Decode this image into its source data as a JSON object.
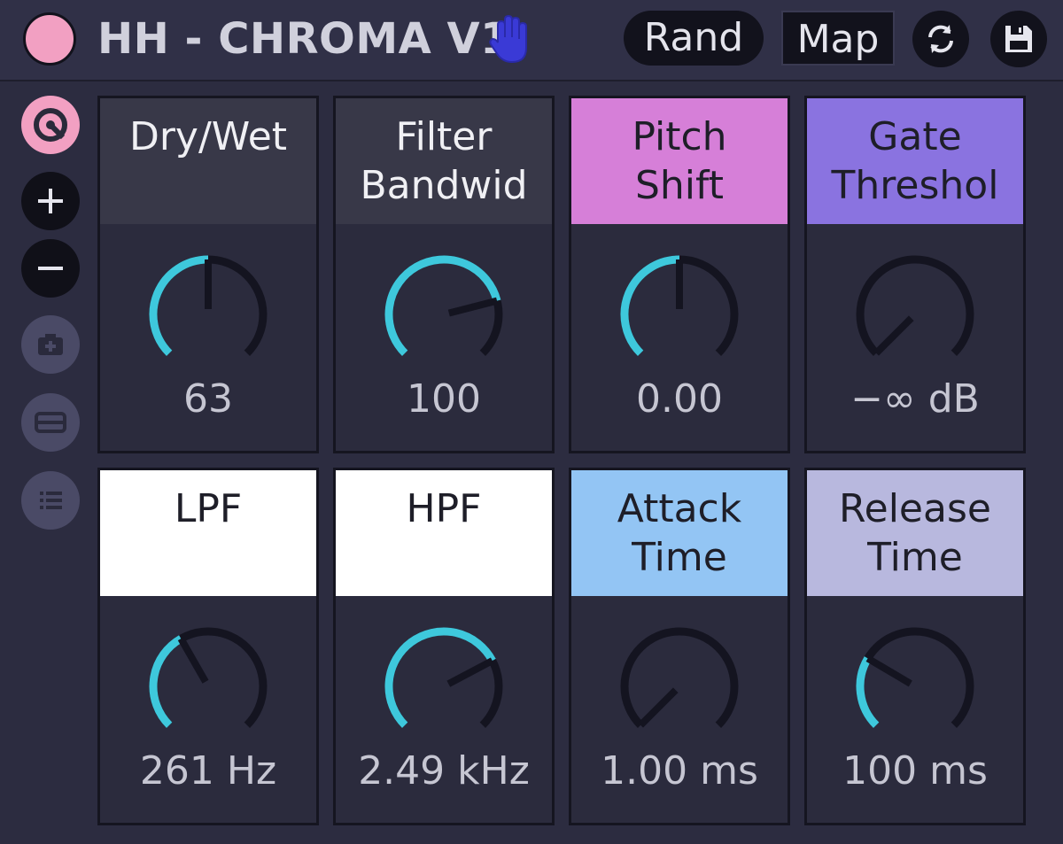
{
  "header": {
    "title": "HH - CHROMA V1",
    "rand_label": "Rand",
    "map_label": "Map",
    "power_color": "#f2a0c2",
    "hand_icon": "hand-icon",
    "sync_icon": "sync-icon",
    "save_icon": "save-icon"
  },
  "sidebar": {
    "items": [
      {
        "name": "chroma-logo-button",
        "icon": "logo-icon"
      },
      {
        "name": "add-button",
        "icon": "plus-icon"
      },
      {
        "name": "remove-button",
        "icon": "minus-icon"
      },
      {
        "name": "snapshot-button",
        "icon": "camera-plus-icon"
      },
      {
        "name": "card-button",
        "icon": "card-icon"
      },
      {
        "name": "list-button",
        "icon": "list-icon"
      }
    ]
  },
  "macros": [
    {
      "label": "Dry/Wet",
      "value": "63",
      "header_color": "#383848",
      "text_color": "#f0f0f4",
      "level": 0.5
    },
    {
      "label": "Filter\nBandwid",
      "value": "100",
      "header_color": "#383848",
      "text_color": "#f0f0f4",
      "level": 0.78
    },
    {
      "label": "Pitch\nShift",
      "value": "0.00",
      "header_color": "#d67fd8",
      "text_color": "#1e1e28",
      "level": 0.5
    },
    {
      "label": "Gate\nThreshol",
      "value": "−∞ dB",
      "header_color": "#8a73e0",
      "text_color": "#1e1e28",
      "level": 0.0
    },
    {
      "label": "LPF",
      "value": "261 Hz",
      "header_color": "#ffffff",
      "text_color": "#1e1e28",
      "level": 0.39
    },
    {
      "label": "HPF",
      "value": "2.49 kHz",
      "header_color": "#ffffff",
      "text_color": "#1e1e28",
      "level": 0.73
    },
    {
      "label": "Attack\nTime",
      "value": "1.00 ms",
      "header_color": "#93c5f4",
      "text_color": "#1e1e28",
      "level": 0.0
    },
    {
      "label": "Release\nTime",
      "value": "100 ms",
      "header_color": "#b8b8de",
      "text_color": "#1e1e28",
      "level": 0.28
    }
  ],
  "colors": {
    "accent": "#3ec8dc",
    "knob_track": "#141420",
    "panel": "#2b2b3d",
    "background": "#2c2c40"
  }
}
